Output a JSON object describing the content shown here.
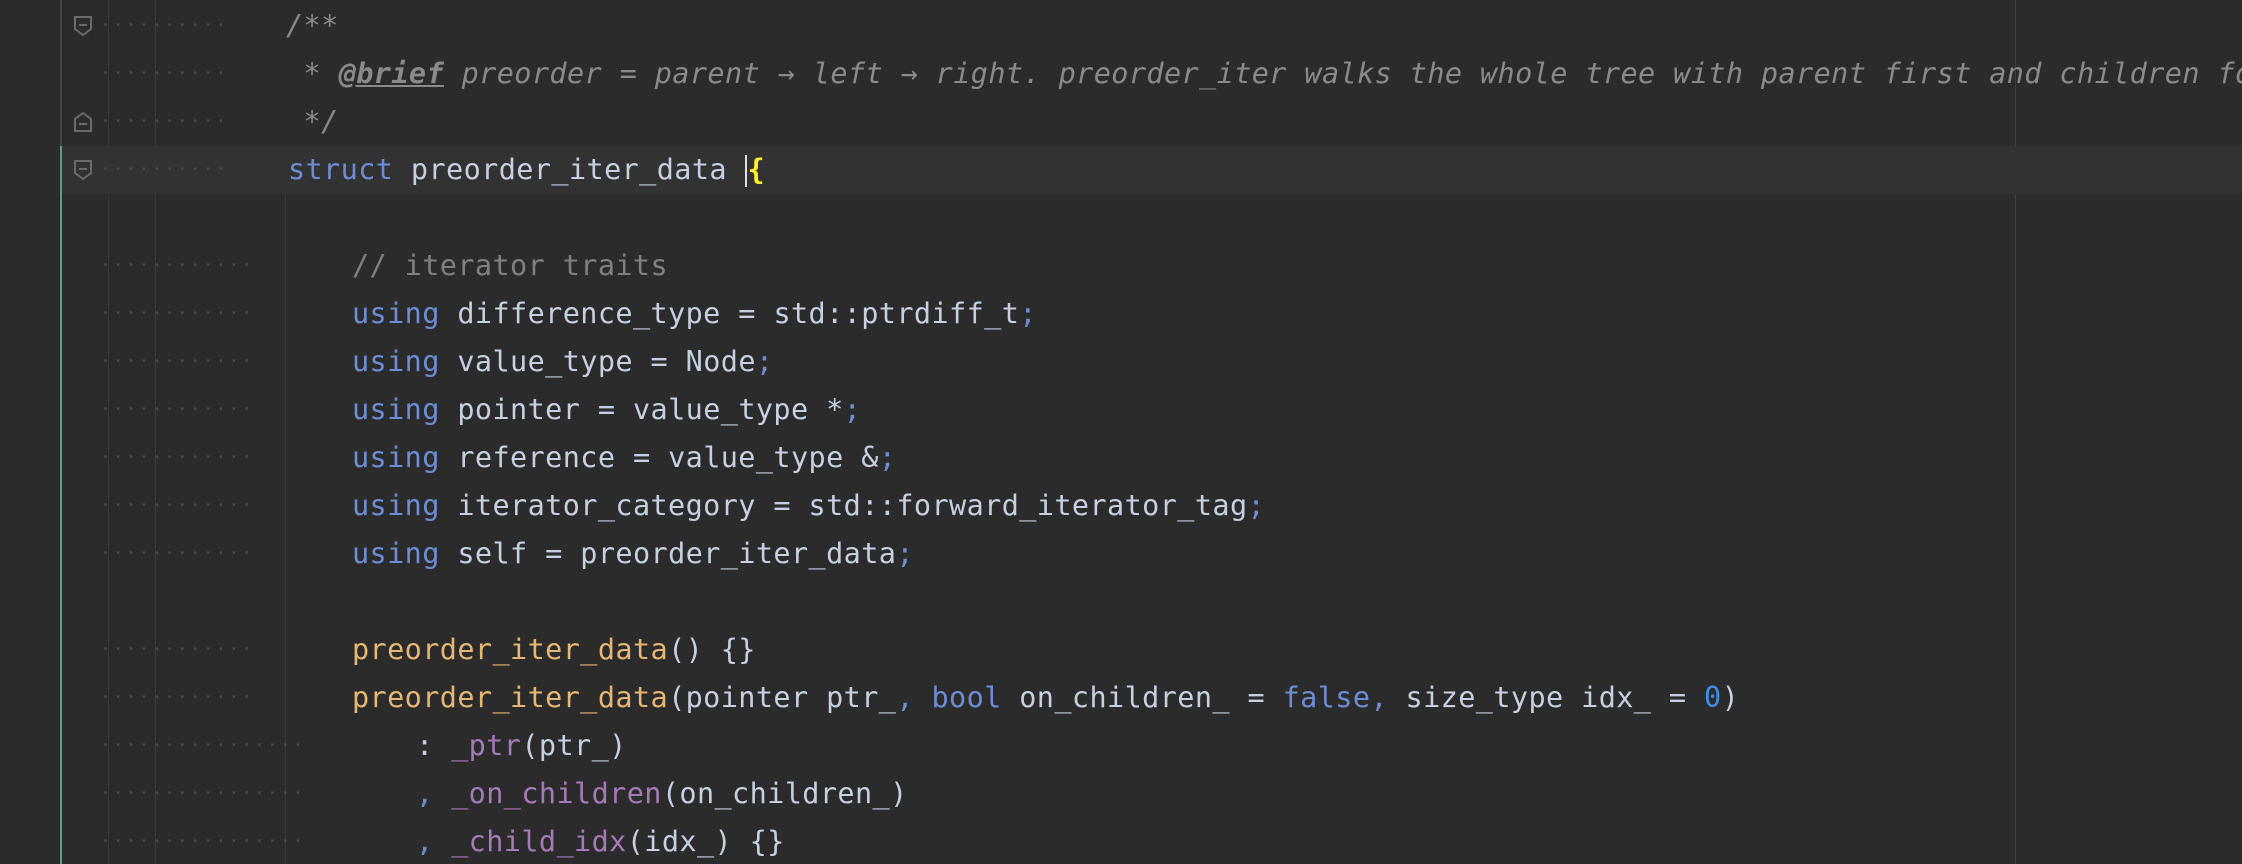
{
  "editor": {
    "lines": {
      "l1": {
        "text": "/**"
      },
      "l2": {
        "star": " *",
        "tag": "@brief",
        "text": " preorder = parent → left → right. preorder_iter walks the whole tree with parent first and children followed."
      },
      "l3": {
        "text": " */"
      },
      "l4": {
        "kw": "struct",
        "name": "preorder_iter_data",
        "brace": "{"
      },
      "l6": {
        "text": "// iterator traits"
      },
      "l7": {
        "kw": "using",
        "name": "difference_type",
        "eq": " = ",
        "type": "std::ptrdiff_t",
        "semi": ";"
      },
      "l8": {
        "kw": "using",
        "name": "value_type",
        "eq": " = ",
        "type": "Node",
        "semi": ";"
      },
      "l9": {
        "kw": "using",
        "name": "pointer",
        "eq": " = ",
        "type": "value_type *",
        "semi": ";"
      },
      "l10": {
        "kw": "using",
        "name": "reference",
        "eq": " = ",
        "type": "value_type &",
        "semi": ";"
      },
      "l11": {
        "kw": "using",
        "name": "iterator_category",
        "eq": " = ",
        "type": "std::forward_iterator_tag",
        "semi": ";"
      },
      "l12": {
        "kw": "using",
        "name": "self",
        "eq": " = ",
        "type": "preorder_iter_data",
        "semi": ";"
      },
      "l14": {
        "fn": "preorder_iter_data",
        "rest": "() {}"
      },
      "l15": {
        "fn": "preorder_iter_data",
        "open": "(pointer ptr_",
        "comma1": ", ",
        "kw_bool": "bool",
        "mid": " on_children_ = ",
        "false": "false",
        "comma2": ", ",
        "tail": "size_type idx_ = ",
        "zero": "0",
        "close": ")"
      },
      "l16": {
        "colon": ": ",
        "mem": "_ptr",
        "args": "(ptr_)"
      },
      "l17": {
        "comma": ", ",
        "mem": "_on_children",
        "args": "(on_children_)"
      },
      "l18": {
        "comma": ", ",
        "mem": "_child_idx",
        "args": "(idx_) {}"
      }
    },
    "colors": {
      "background": "#2b2b2b",
      "keyword": "#6f8dd6",
      "function": "#e6b673",
      "member": "#a57ab8",
      "number": "#3f8ee8",
      "comment": "#808080",
      "identifier": "#c7d0e0",
      "brace_highlight": "#ffef28"
    },
    "icons": [
      "fold-collapse-icon",
      "fold-end-icon"
    ]
  }
}
